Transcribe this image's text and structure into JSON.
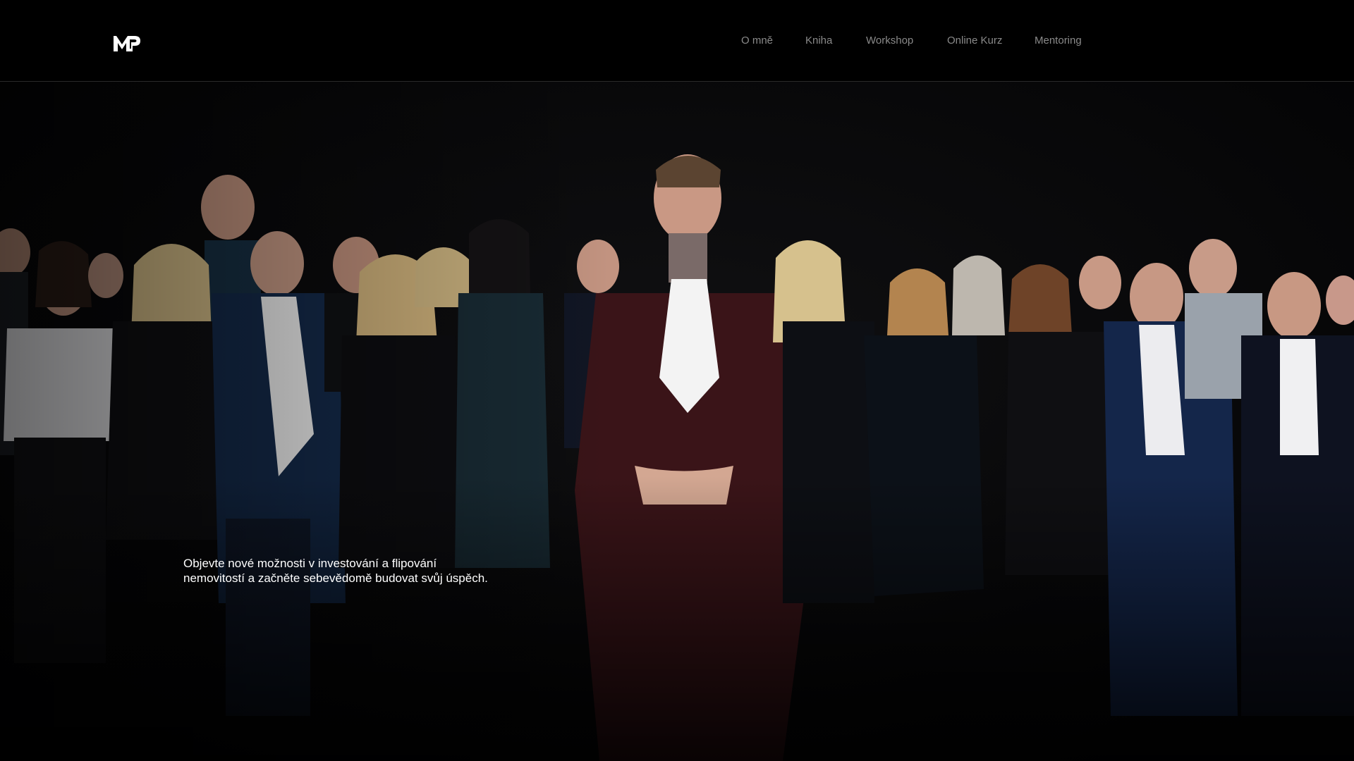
{
  "header": {
    "logo_text": "MP",
    "logo_icon": "mp-monogram-logo"
  },
  "nav": {
    "items": [
      {
        "label": "O mně"
      },
      {
        "label": "Kniha"
      },
      {
        "label": "Workshop"
      },
      {
        "label": "Online Kurz"
      },
      {
        "label": "Mentoring"
      }
    ]
  },
  "hero": {
    "image": "group-photo-team-in-formal-attire",
    "tagline_line1": "Objevte nové možnosti v investování a flipování",
    "tagline_line2": "nemovitostí a začněte sebevědomě budovat svůj úspěch."
  },
  "colors": {
    "background": "#000000",
    "nav_text": "#8a8a8a",
    "tagline_text": "#ffffff",
    "accent_suit": "#3a1418"
  }
}
